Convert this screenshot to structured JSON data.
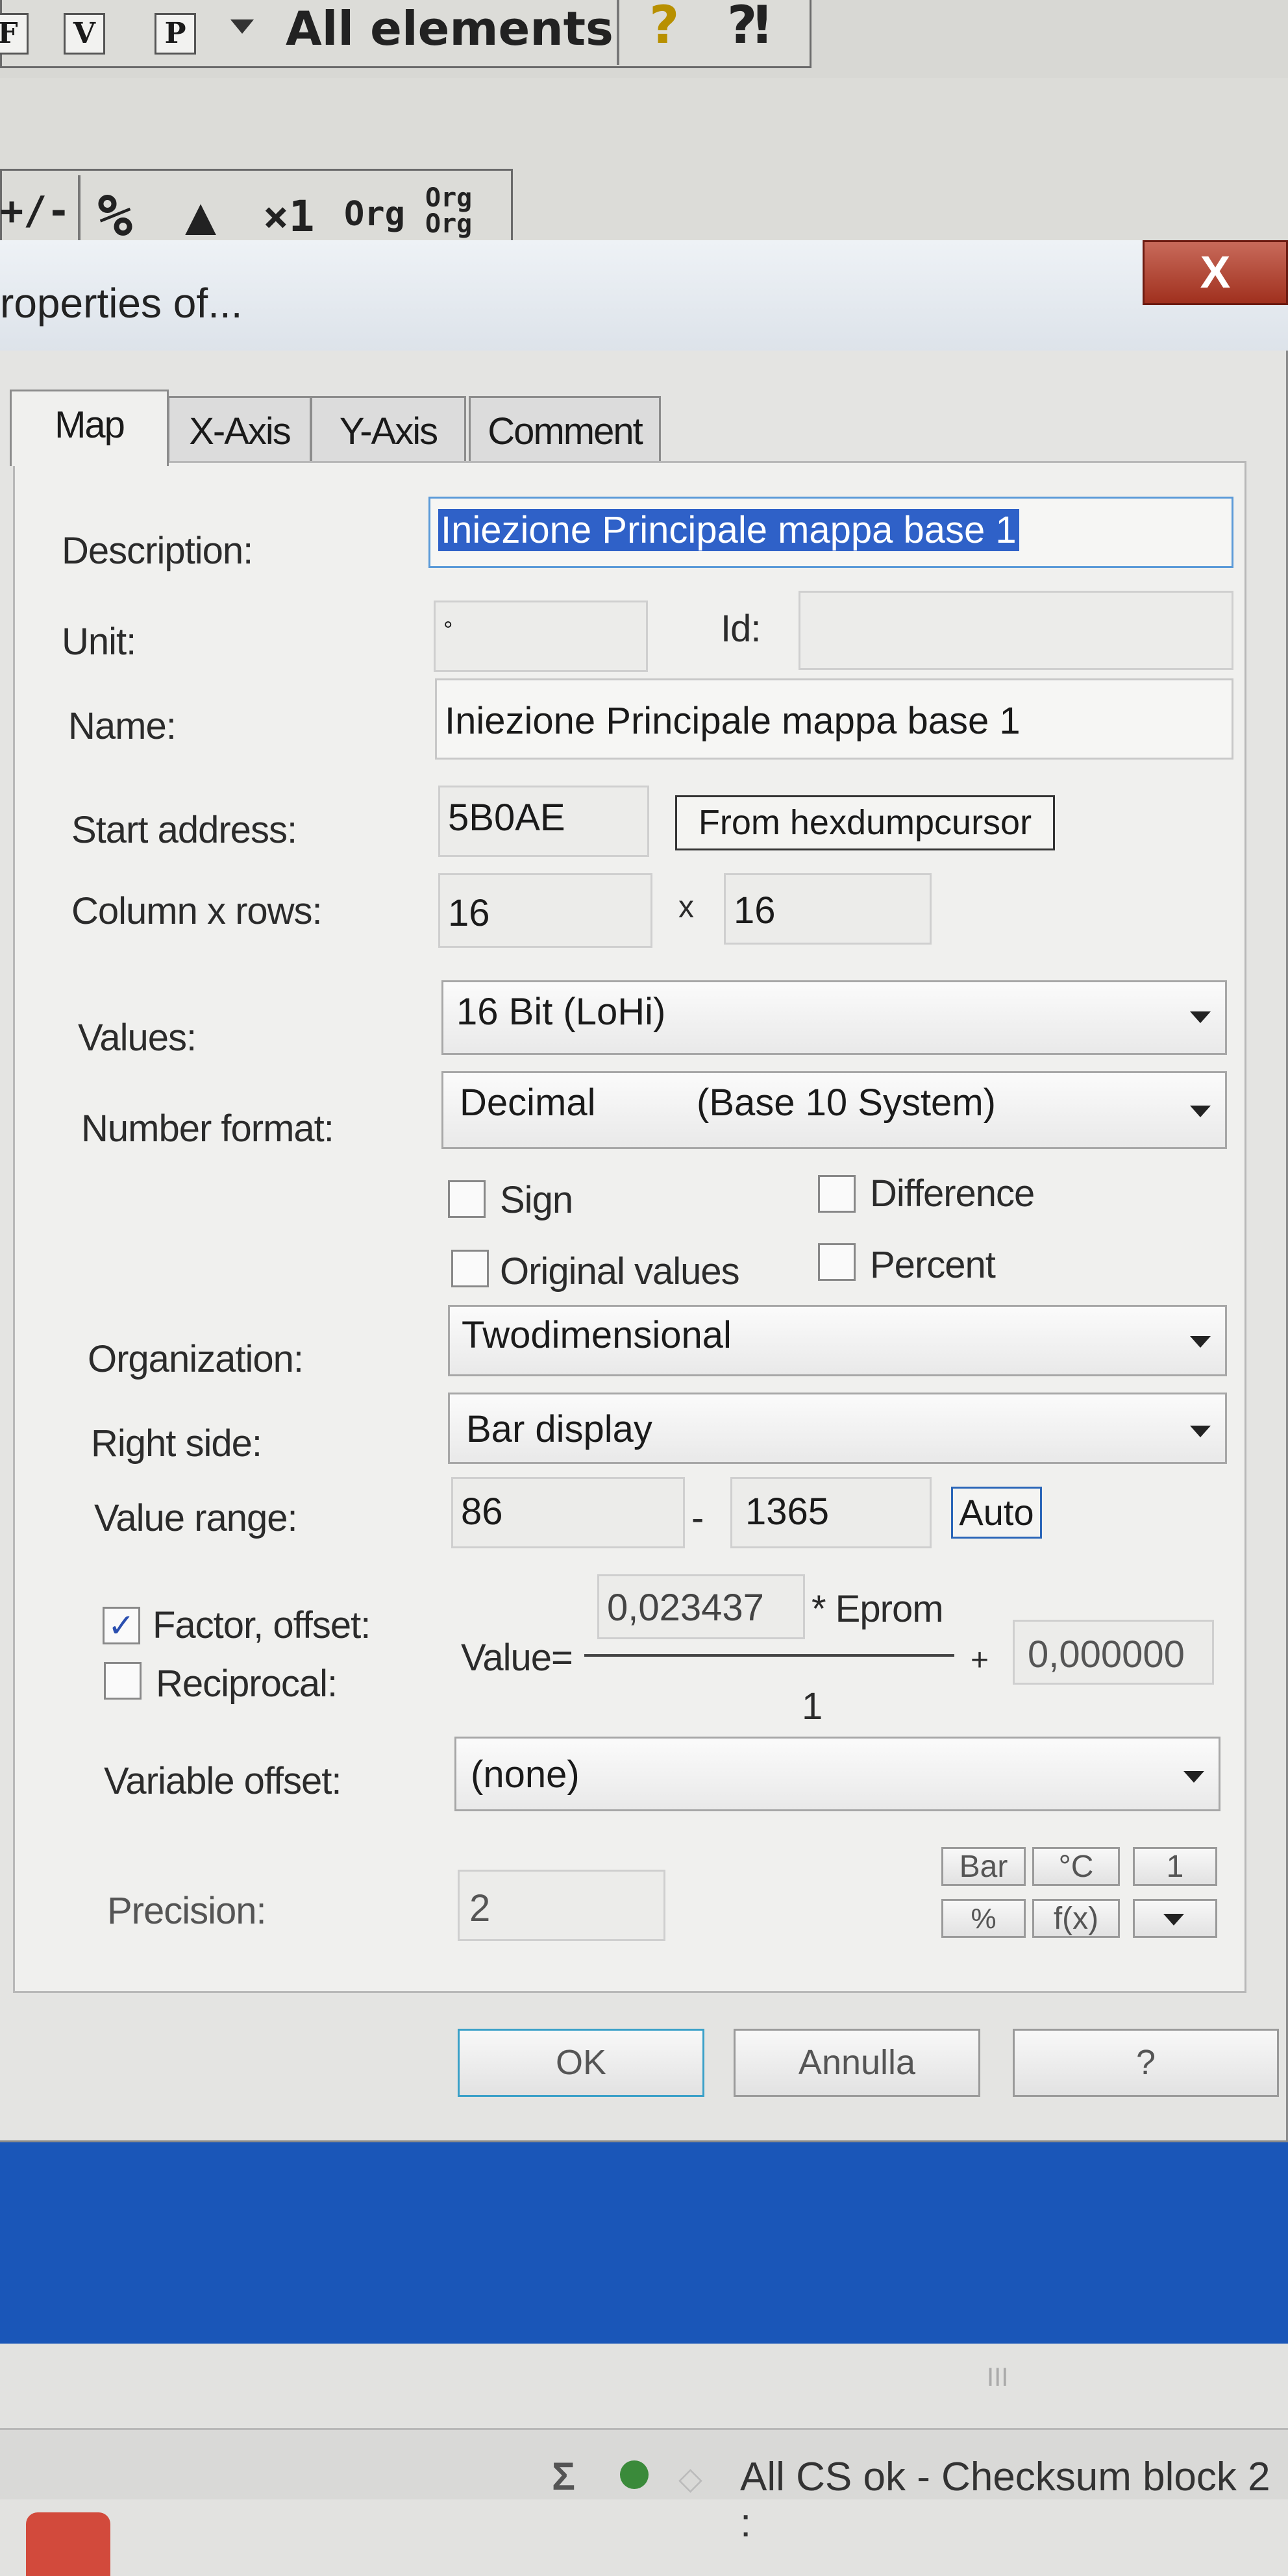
{
  "toolbar": {
    "buttons": [
      "F",
      "V",
      "P"
    ],
    "view_select": "All elements",
    "help_glyphs": [
      "?",
      "⁈"
    ],
    "row2_items": [
      "+/-",
      "%",
      "▲",
      "×1",
      "Org",
      "Org\nOrg"
    ]
  },
  "dialog": {
    "title": "roperties of...",
    "close_glyph": "X",
    "tabs": [
      "Map",
      "X-Axis",
      "Y-Axis",
      "Comment"
    ],
    "labels": {
      "description": "Description:",
      "unit": "Unit:",
      "id": "Id:",
      "name": "Name:",
      "start_address": "Start address:",
      "column_rows": "Column x rows:",
      "values": "Values:",
      "number_format": "Number format:",
      "organization": "Organization:",
      "right_side": "Right side:",
      "value_range": "Value range:",
      "factor_offset": "Factor, offset:",
      "reciprocal": "Reciprocal:",
      "variable_offset": "Variable offset:",
      "precision": "Precision:"
    },
    "fields": {
      "description": "Iniezione Principale mappa base 1",
      "unit": "°",
      "id": "",
      "name": "Iniezione Principale mappa base 1",
      "start_address": "5B0AE",
      "columns": "16",
      "rows_sep": "x",
      "rows": "16",
      "range_min": "86",
      "range_sep": "-",
      "range_max": "1365",
      "precision": "2"
    },
    "selects": {
      "values": "16 Bit (LoHi)",
      "number_format_a": "Decimal",
      "number_format_b": "(Base 10 System)",
      "organization": "Twodimensional",
      "right_side": "Bar display",
      "variable_offset": "(none)"
    },
    "checkboxes": {
      "sign": "Sign",
      "difference": "Difference",
      "original_values": "Original values",
      "percent": "Percent"
    },
    "formula": {
      "prefix": "Value=",
      "factor": "0,023437",
      "eprom": "* Eprom",
      "plus": "+",
      "offset": "0,000000",
      "divisor": "1"
    },
    "buttons": {
      "from_hexdump": "From hexdumpcursor",
      "auto": "Auto",
      "bar": "Bar",
      "celsius": "°C",
      "one": "1",
      "percent": "%",
      "fx": "f(x)",
      "ok": "OK",
      "cancel": "Annulla",
      "help": "?"
    }
  },
  "status": {
    "text": "All CS ok - Checksum block 2 :",
    "scroll_glyph": "III"
  },
  "colors": {
    "desktop": "#1a56b8",
    "selection": "#2f61c8",
    "close": "#a0301e"
  }
}
